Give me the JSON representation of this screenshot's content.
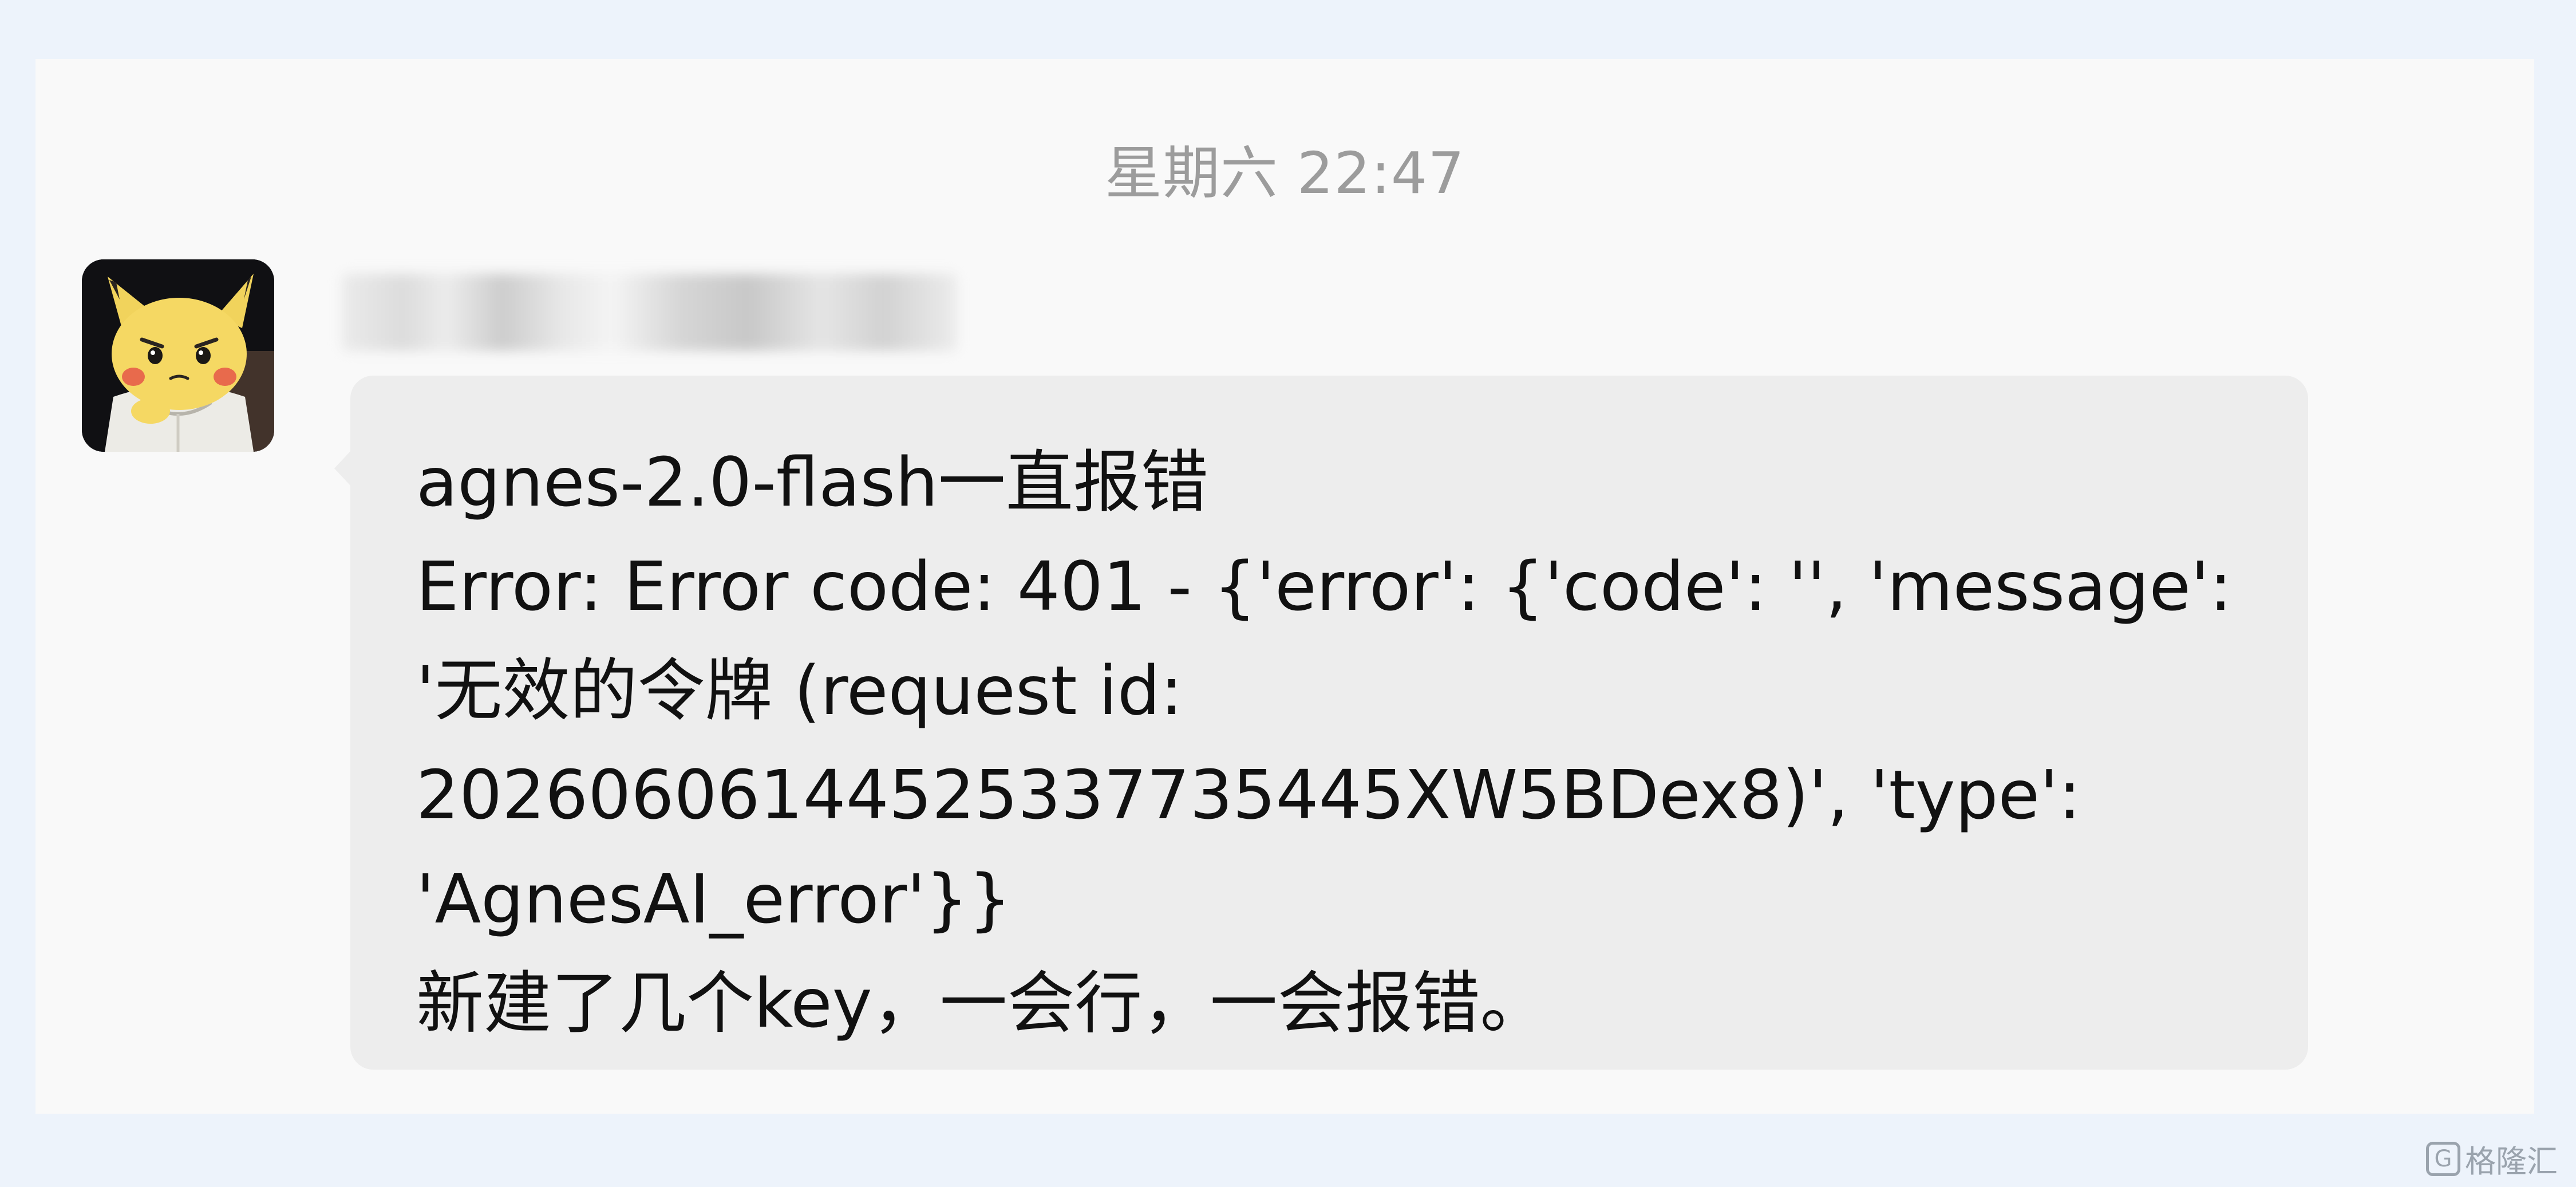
{
  "chat": {
    "timestamp": "星期六 22:47",
    "message": {
      "sender_name": "",
      "text_lines": [
        "agnes-2.0-flash一直报错",
        "Error: Error code: 401 - {'error': {'code': '', 'message':",
        "'无效的令牌 (request id:",
        "20260606144525337735445XW5BDex8)', 'type':",
        "'AgnesAI_error'}}",
        "新建了几个key，一会行，一会报错。"
      ]
    }
  },
  "watermark": {
    "logo_glyph": "G",
    "text": "格隆汇"
  },
  "colors": {
    "page_background": "#edf3fb",
    "panel_background": "#f9f9f9",
    "bubble_background": "#ededed",
    "timestamp_text": "#9c9c9c",
    "message_text": "#111111"
  },
  "icons": {
    "avatar": "pikachu-avatar-icon",
    "watermark": "gelonghui-logo-icon"
  }
}
